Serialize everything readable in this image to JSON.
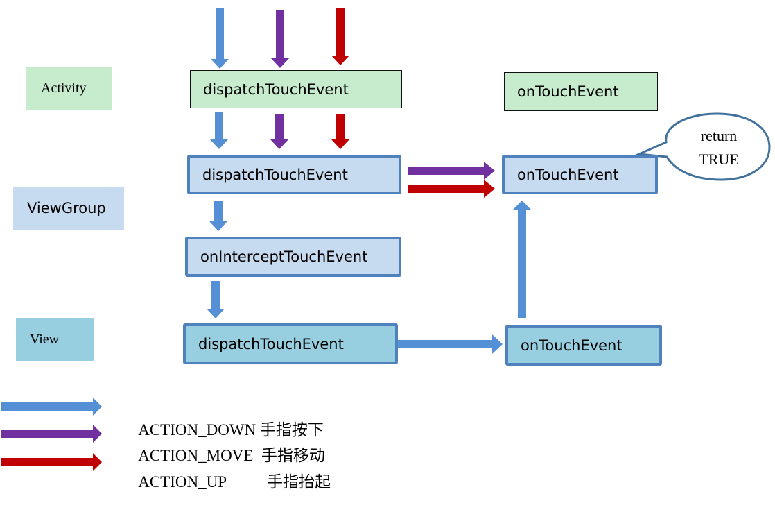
{
  "colors": {
    "action_down": "#5590d6",
    "action_move": "#7030a0",
    "action_up": "#c00000",
    "activity_fill": "#c6ebcd",
    "viewgroup_fill": "#c6daf0",
    "view_fill": "#97cfe0",
    "box_border": "#4f81bd"
  },
  "layers": {
    "activity": "Activity",
    "viewgroup": "ViewGroup",
    "view": "View"
  },
  "nodes": {
    "activity_dispatch": "dispatchTouchEvent",
    "activity_ontouch": "onTouchEvent",
    "viewgroup_dispatch": "dispatchTouchEvent",
    "viewgroup_intercept": "onInterceptTouchEvent",
    "viewgroup_ontouch": "onTouchEvent",
    "view_dispatch": "dispatchTouchEvent",
    "view_ontouch": "onTouchEvent"
  },
  "callout": {
    "line1": "return",
    "line2": "TRUE"
  },
  "legend": [
    {
      "event": "ACTION_DOWN",
      "desc": "手指按下",
      "color_key": "action_down"
    },
    {
      "event": "ACTION_MOVE",
      "desc": "手指移动",
      "color_key": "action_move"
    },
    {
      "event": "ACTION_UP",
      "desc": "手指抬起",
      "color_key": "action_up"
    }
  ]
}
